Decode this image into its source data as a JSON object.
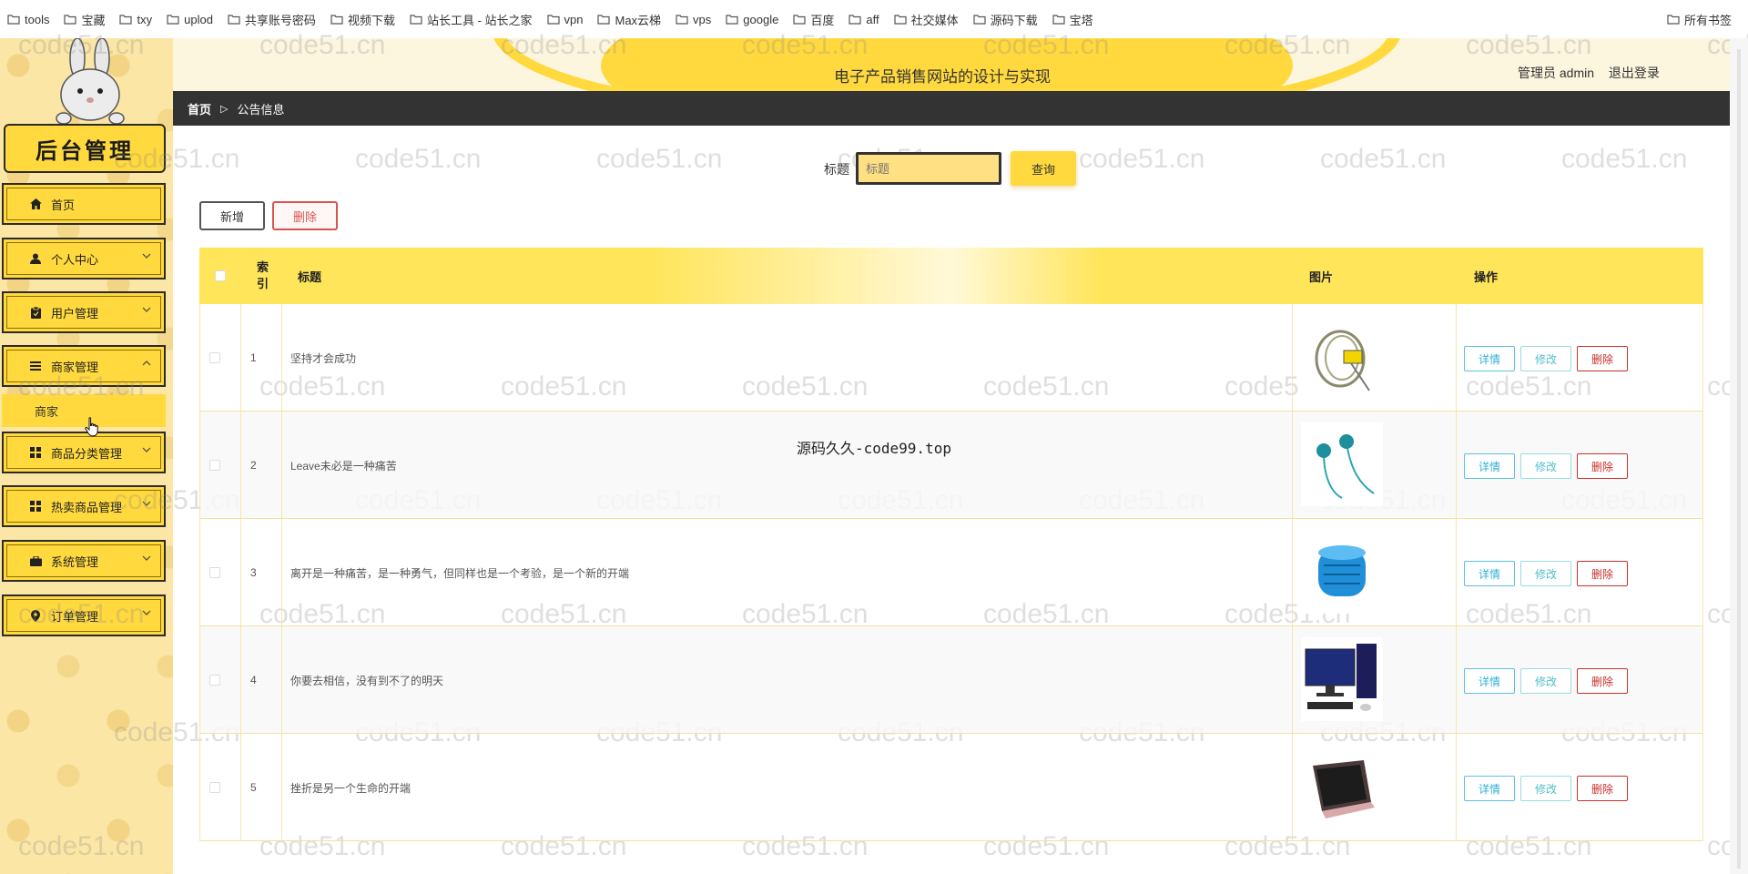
{
  "bookmarks": {
    "items": [
      "tools",
      "宝藏",
      "txy",
      "uplod",
      "共享账号密码",
      "视频下载",
      "站长工具 - 站长之家",
      "vpn",
      "Max云梯",
      "vps",
      "google",
      "百度",
      "aff",
      "社交媒体",
      "源码下载",
      "宝塔"
    ],
    "right": "所有书签"
  },
  "sidebar": {
    "logo_text": "后台管理",
    "menu": [
      {
        "label": "首页",
        "icon": "home-icon"
      },
      {
        "label": "个人中心",
        "icon": "user-icon"
      },
      {
        "label": "用户管理",
        "icon": "clipboard-icon"
      },
      {
        "label": "商家管理",
        "icon": "list-icon"
      },
      {
        "label": "商品分类管理",
        "icon": "grid-icon"
      },
      {
        "label": "热卖商品管理",
        "icon": "grid-icon"
      },
      {
        "label": "系统管理",
        "icon": "briefcase-icon"
      },
      {
        "label": "订单管理",
        "icon": "pin-icon"
      }
    ],
    "submenu_label": "商家"
  },
  "header": {
    "title": "电子产品销售网站的设计与实现",
    "user_label": "管理员 admin",
    "logout_label": "退出登录"
  },
  "breadcrumb": {
    "home": "首页",
    "current": "公告信息"
  },
  "search": {
    "label": "标题",
    "value": "",
    "placeholder": "标题",
    "button": "查询"
  },
  "toolbar": {
    "add": "新增",
    "delete": "删除"
  },
  "table": {
    "headers": {
      "index": "索引",
      "title": "标题",
      "image": "图片",
      "action": "操作"
    },
    "rows": [
      {
        "index": "1",
        "title": "坚持才会成功",
        "image": "cable-product"
      },
      {
        "index": "2",
        "title": "Leave未必是一种痛苦",
        "image": "earphones-product"
      },
      {
        "index": "3",
        "title": "离开是一种痛苦，是一种勇气，但同样也是一个考验，是一个新的开端",
        "image": "speaker-product"
      },
      {
        "index": "4",
        "title": "你要去相信，没有到不了的明天",
        "image": "desktop-pc-product"
      },
      {
        "index": "5",
        "title": "挫折是另一个生命的开端",
        "image": "laptop-product"
      }
    ],
    "op_labels": {
      "detail": "详情",
      "edit": "修改",
      "delete": "删除"
    }
  },
  "overlay": "源码久久-code99.top",
  "watermark": "code51.cn",
  "colors": {
    "accent": "#ffd93d",
    "dark_bar": "#333333",
    "info": "#5bc0de",
    "danger": "#c9302c"
  }
}
